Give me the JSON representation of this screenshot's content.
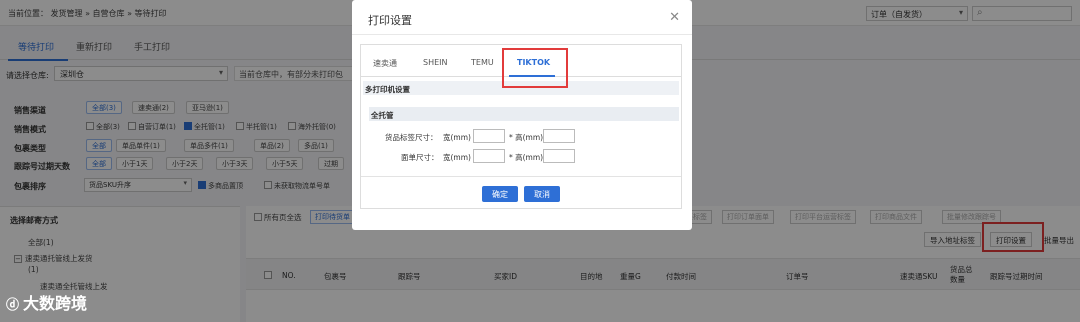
{
  "breadcrumb": "当前位置： 发货管理 » 自营仓库 » 等待打印",
  "order_select": {
    "value": "订单（自发货）"
  },
  "tabs": [
    {
      "label": "等待打印"
    },
    {
      "label": "重新打印"
    },
    {
      "label": "手工打印"
    }
  ],
  "warehouse": {
    "label": "请选择仓库:",
    "value": "深圳仓",
    "tip": "当前仓库中，有部分未打印包"
  },
  "filters": {
    "sales_channel": {
      "label": "销售渠道",
      "options": [
        "全部(3)",
        "速卖通(2)",
        "亚马逊(1)"
      ]
    },
    "sales_mode": {
      "label": "销售模式",
      "options": [
        "全部(3)",
        "自营订单(1)",
        "全托管(1)",
        "半托管(1)",
        "海外托管(0)"
      ]
    },
    "package_type": {
      "label": "包裹类型",
      "options": [
        "全部",
        "单品单件(1)",
        "单品多件(1)",
        "单品(2)",
        "多品(1)"
      ]
    },
    "tracking_expire": {
      "label": "跟踪号过期天数",
      "options": [
        "全部",
        "小于1天",
        "小于2天",
        "小于3天",
        "小于5天",
        "过期"
      ]
    },
    "package_sort": {
      "label": "包裹排序",
      "sort_value": "货品SKU升序",
      "opt1": "多商品置顶",
      "opt2": "未获取物流单号单"
    }
  },
  "left_panel": {
    "title": "选择邮寄方式",
    "items": [
      "全部(1)",
      "速卖通托管线上发货",
      "(1)",
      "速卖通全托管线上发"
    ]
  },
  "main_panel": {
    "select_all_label": "所有页全选",
    "buttons": [
      "打印待货单",
      "打印包裹标签",
      "打印订单面单",
      "打印平台运营标签",
      "打印商品文件",
      "批量修改跟踪号"
    ],
    "import_label": "导入地址标签",
    "print_settings_label": "打印设置",
    "batch_export": "批量导出"
  },
  "table_headers": [
    "NO.",
    "包裹号",
    "跟踪号",
    "买家ID",
    "目的地",
    "重量G",
    "付款时间",
    "订单号",
    "速卖通SKU",
    "货品总数量",
    "跟踪号过期时间"
  ],
  "modal": {
    "title": "打印设置",
    "tabs": [
      "速卖通",
      "SHEIN",
      "TEMU",
      "TIKTOK"
    ],
    "section": "多打印机设置",
    "subsection": "全托管",
    "rows": [
      {
        "label": "货品标签尺寸：",
        "w_label": "宽(mm)",
        "h_label": "* 高(mm)"
      },
      {
        "label": "面单尺寸：",
        "w_label": "宽(mm)",
        "h_label": "* 高(mm)"
      }
    ],
    "confirm": "确定",
    "cancel": "取消"
  },
  "watermark": "大数跨境",
  "colors": {
    "accent": "#2e6fd6",
    "highlight": "#e23b3b"
  }
}
